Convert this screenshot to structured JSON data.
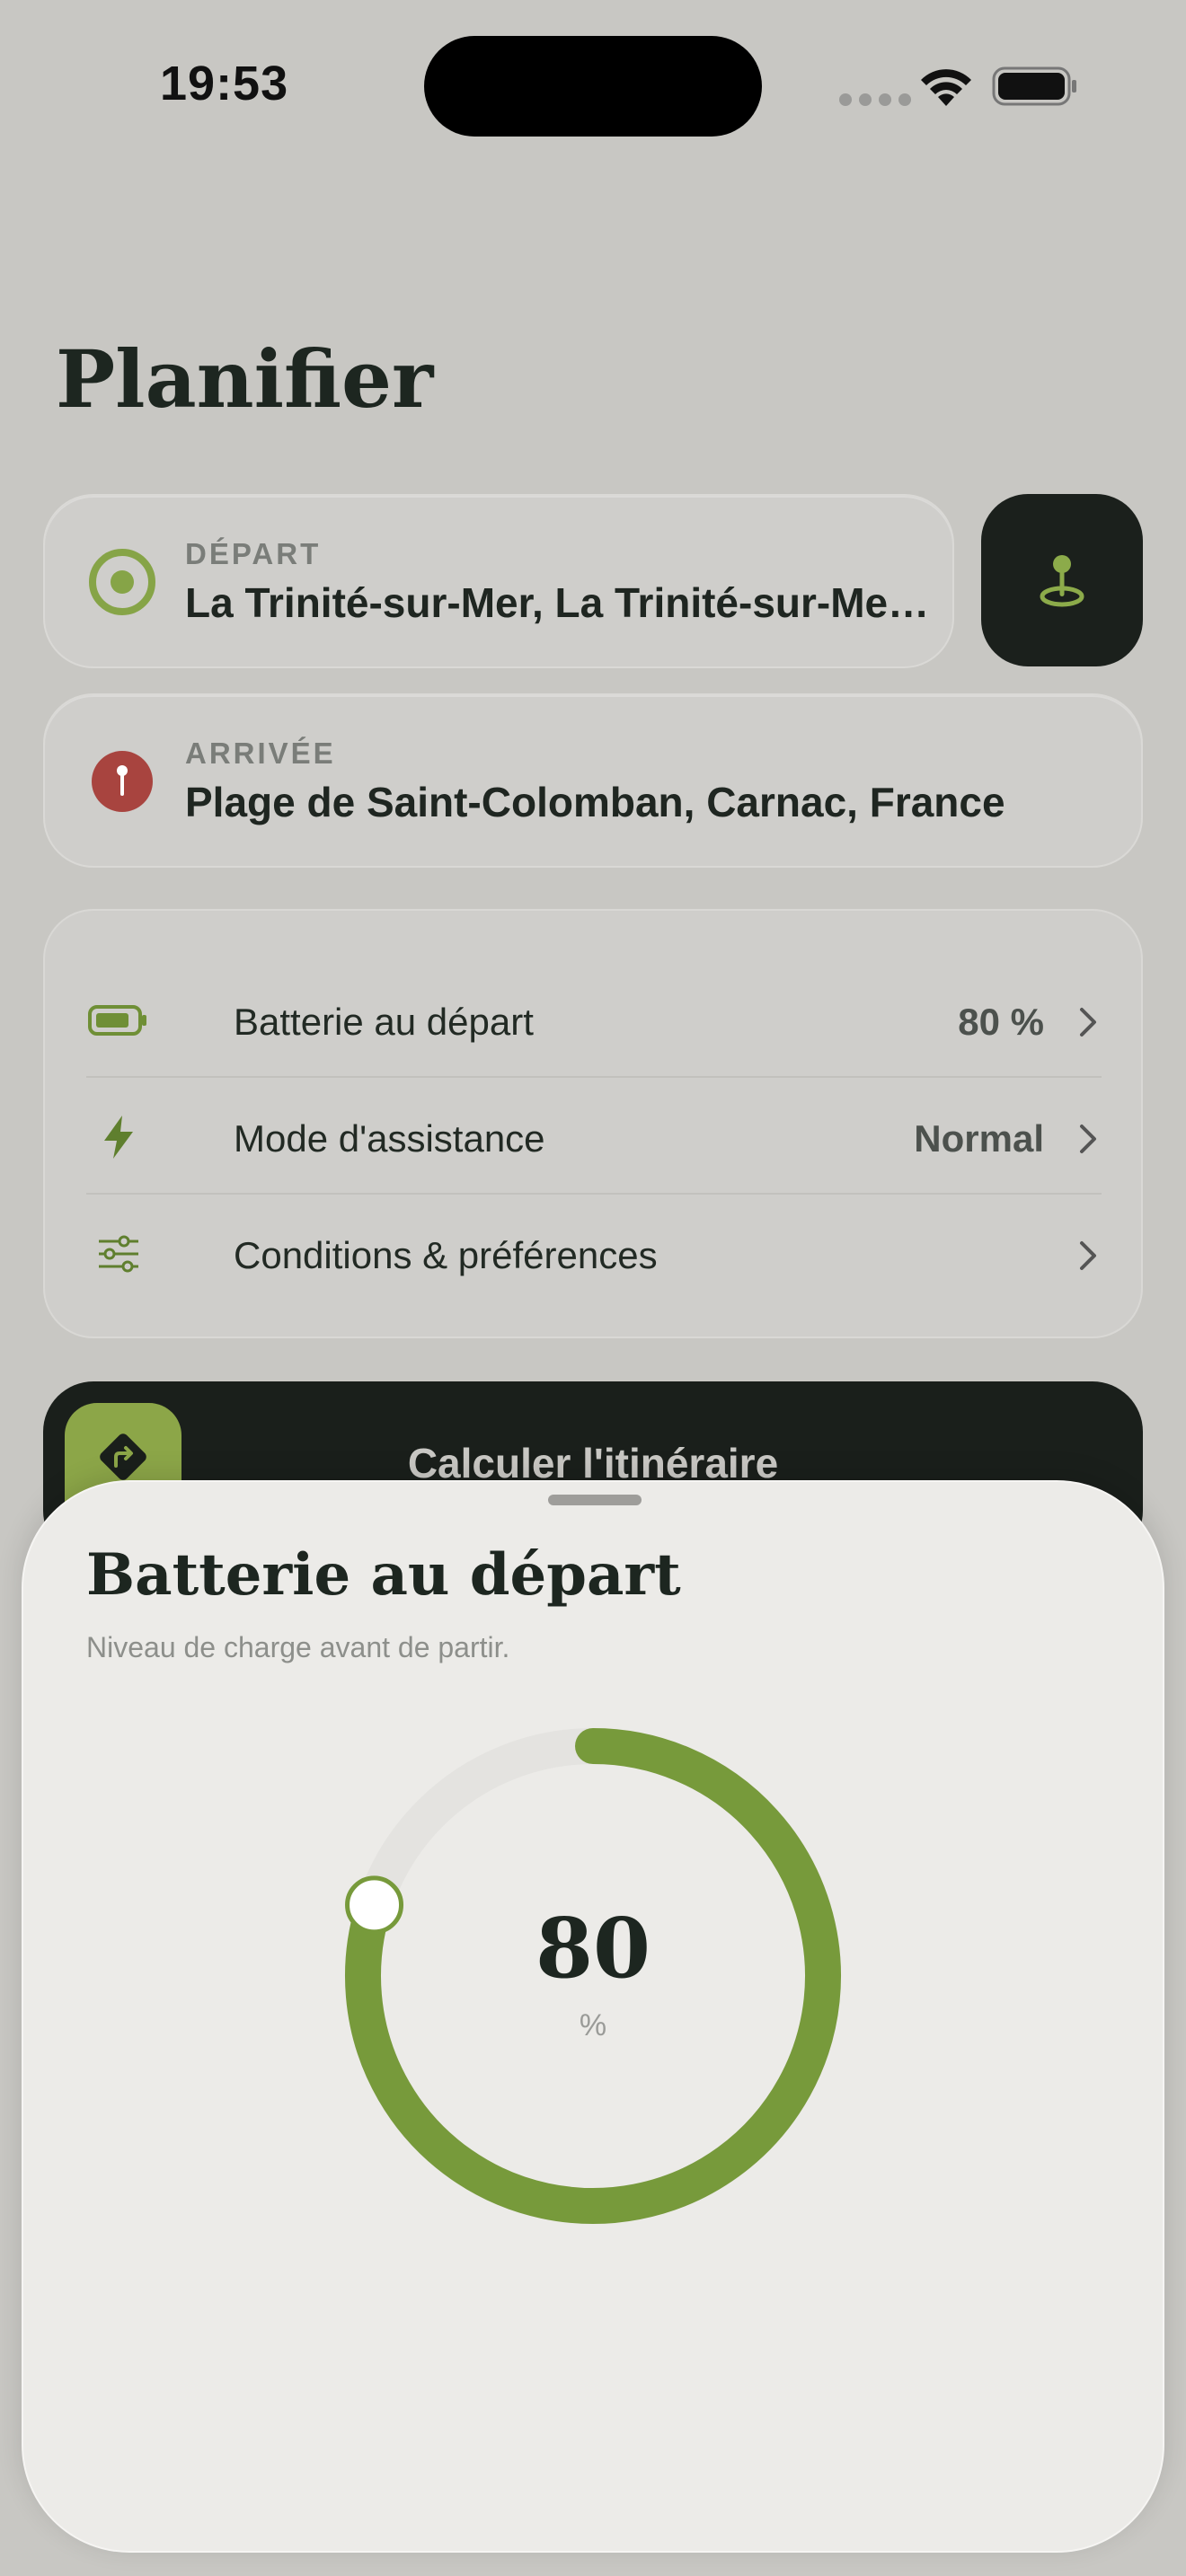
{
  "status_bar": {
    "time": "19:53"
  },
  "page": {
    "title": "Planifier"
  },
  "depart": {
    "label": "DÉPART",
    "value": "La Trinité-sur-Mer, La Trinité-sur-Mer, France"
  },
  "arrivee": {
    "label": "ARRIVÉE",
    "value": "Plage de Saint-Colomban, Carnac, France"
  },
  "settings": {
    "items": [
      {
        "label": "Batterie au départ",
        "value": "80 %",
        "icon": "battery-icon"
      },
      {
        "label": "Mode d'assistance",
        "value": "Normal",
        "icon": "bolt-icon"
      },
      {
        "label": "Conditions & préférences",
        "value": "",
        "icon": "sliders-icon"
      }
    ]
  },
  "calculate": {
    "label": "Calculer l'itinéraire"
  },
  "sheet": {
    "title": "Batterie au départ",
    "subtitle": "Niveau de charge avant de partir.",
    "value": "80",
    "unit": "%",
    "level_percent": 80
  },
  "colors": {
    "accent_green": "#7a9a3c",
    "dark": "#1b201c",
    "destination_red": "#a8443f"
  }
}
